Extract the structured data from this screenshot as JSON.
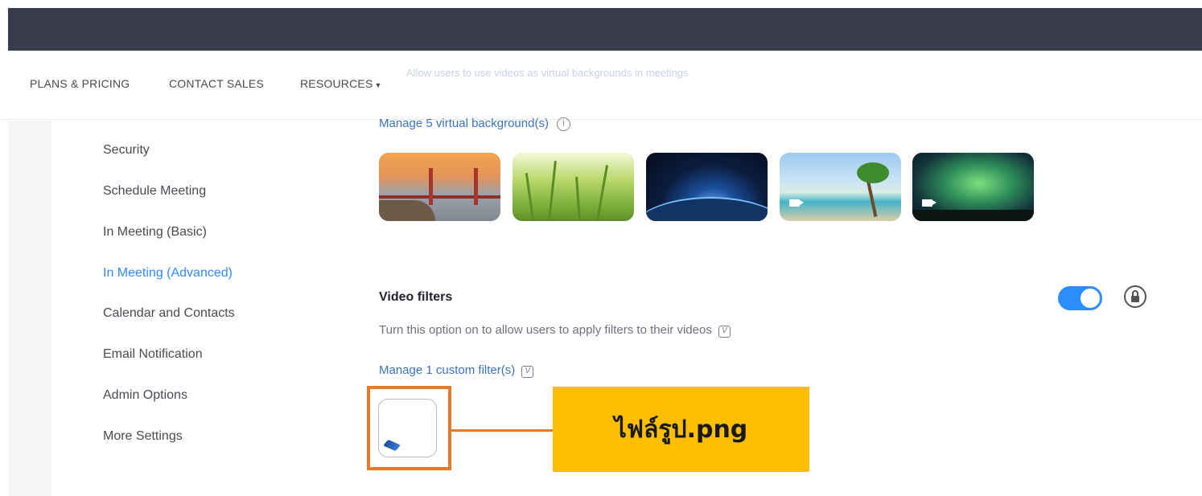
{
  "nav": {
    "plans": "PLANS & PRICING",
    "contact": "CONTACT SALES",
    "resources": "RESOURCES",
    "resources_caret": "▼",
    "faded_text": "Allow users to use videos as virtual backgrounds in meetings"
  },
  "sidebar": {
    "items": [
      {
        "label": "Security",
        "active": false
      },
      {
        "label": "Schedule Meeting",
        "active": false
      },
      {
        "label": "In Meeting (Basic)",
        "active": false
      },
      {
        "label": "In Meeting (Advanced)",
        "active": true
      },
      {
        "label": "Calendar and Contacts",
        "active": false
      },
      {
        "label": "Email Notification",
        "active": false
      },
      {
        "label": "Admin Options",
        "active": false
      },
      {
        "label": "More Settings",
        "active": false
      }
    ]
  },
  "virtual_backgrounds": {
    "manage_label": "Manage 5 virtual background(s)",
    "info_glyph": "i",
    "thumbnails": [
      "golden-gate-bridge",
      "grass",
      "earth-from-space",
      "beach-palm",
      "aurora"
    ]
  },
  "video_filters": {
    "title": "Video filters",
    "description": "Turn this option on to allow users to apply filters to their videos",
    "manage_label": "Manage 1 custom filter(s)",
    "v_glyph": "V",
    "enabled": true
  },
  "annotation": {
    "callout": "ไฟล์รูป.png"
  },
  "colors": {
    "topbar": "#393b4d",
    "accent_blue": "#2d8cff",
    "link_blue": "#3b73b9",
    "highlight_orange": "#e57a28",
    "callout_yellow": "#ffbf00"
  }
}
